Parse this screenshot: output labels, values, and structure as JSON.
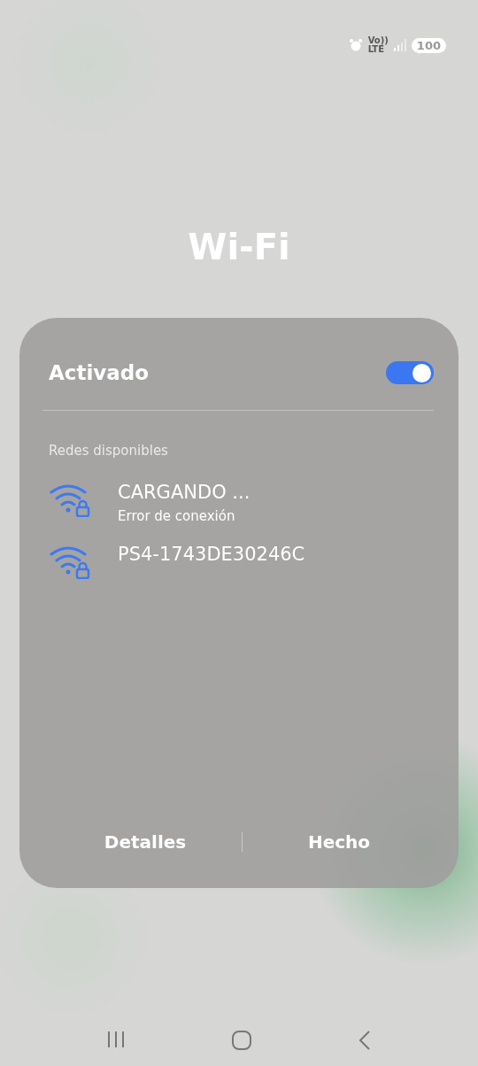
{
  "status_bar": {
    "volte": "Vo))",
    "lte": "LTE",
    "battery": "100"
  },
  "title": "Wi-Fi",
  "panel": {
    "toggle": {
      "label": "Activado",
      "on": true
    },
    "section_label": "Redes disponibles",
    "networks": [
      {
        "name": "CARGANDO ...",
        "status": "Error de conexión",
        "secured": true
      },
      {
        "name": "PS4-1743DE30246C",
        "secured": true
      }
    ],
    "buttons": [
      "Detalles",
      "Hecho"
    ]
  }
}
